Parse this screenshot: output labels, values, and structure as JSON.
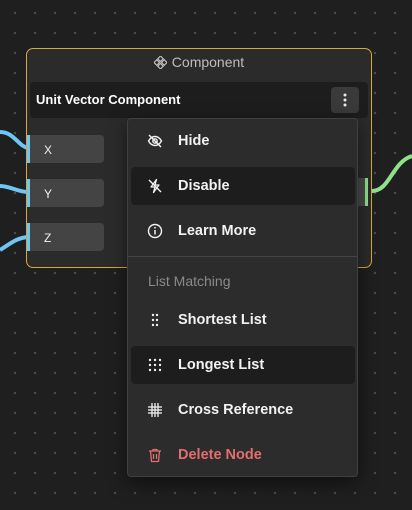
{
  "node": {
    "header": "Component",
    "title": "Unit Vector Component",
    "ports": [
      "X",
      "Y",
      "Z"
    ]
  },
  "menu": {
    "items": [
      {
        "label": "Hide",
        "icon": "eye-off-icon"
      },
      {
        "label": "Disable",
        "icon": "bolt-off-icon"
      },
      {
        "label": "Learn More",
        "icon": "info-icon"
      }
    ],
    "section_label": "List Matching",
    "matching": [
      {
        "label": "Shortest List",
        "icon": "dots-grid-small-icon"
      },
      {
        "label": "Longest List",
        "icon": "dots-grid-large-icon"
      },
      {
        "label": "Cross Reference",
        "icon": "cross-grid-icon"
      }
    ],
    "delete_label": "Delete Node"
  },
  "colors": {
    "node_border": "#d8a93a",
    "input_wire": "#6ec6f5",
    "output_wire": "#8ee38a",
    "danger": "#e46d6d",
    "highlight": "#1d1d1d"
  }
}
